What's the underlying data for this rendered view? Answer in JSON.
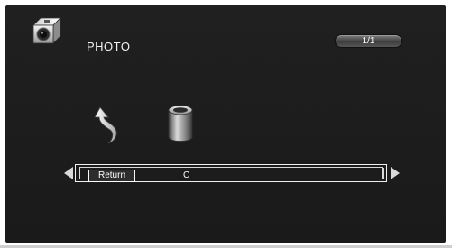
{
  "header": {
    "title": "PHOTO",
    "icon": "camera-icon",
    "page_indicator": "1/1"
  },
  "browser": {
    "items": [
      {
        "label": "Return",
        "icon": "return-arrow-icon",
        "selected": true
      },
      {
        "label": "C",
        "icon": "drive-cylinder-icon",
        "selected": false
      }
    ],
    "nav_left_icon": "triangle-left-icon",
    "nav_right_icon": "triangle-right-icon"
  },
  "colors": {
    "background": "#1e1e1e",
    "text": "#ffffff",
    "badge": "#5a5a5a"
  }
}
